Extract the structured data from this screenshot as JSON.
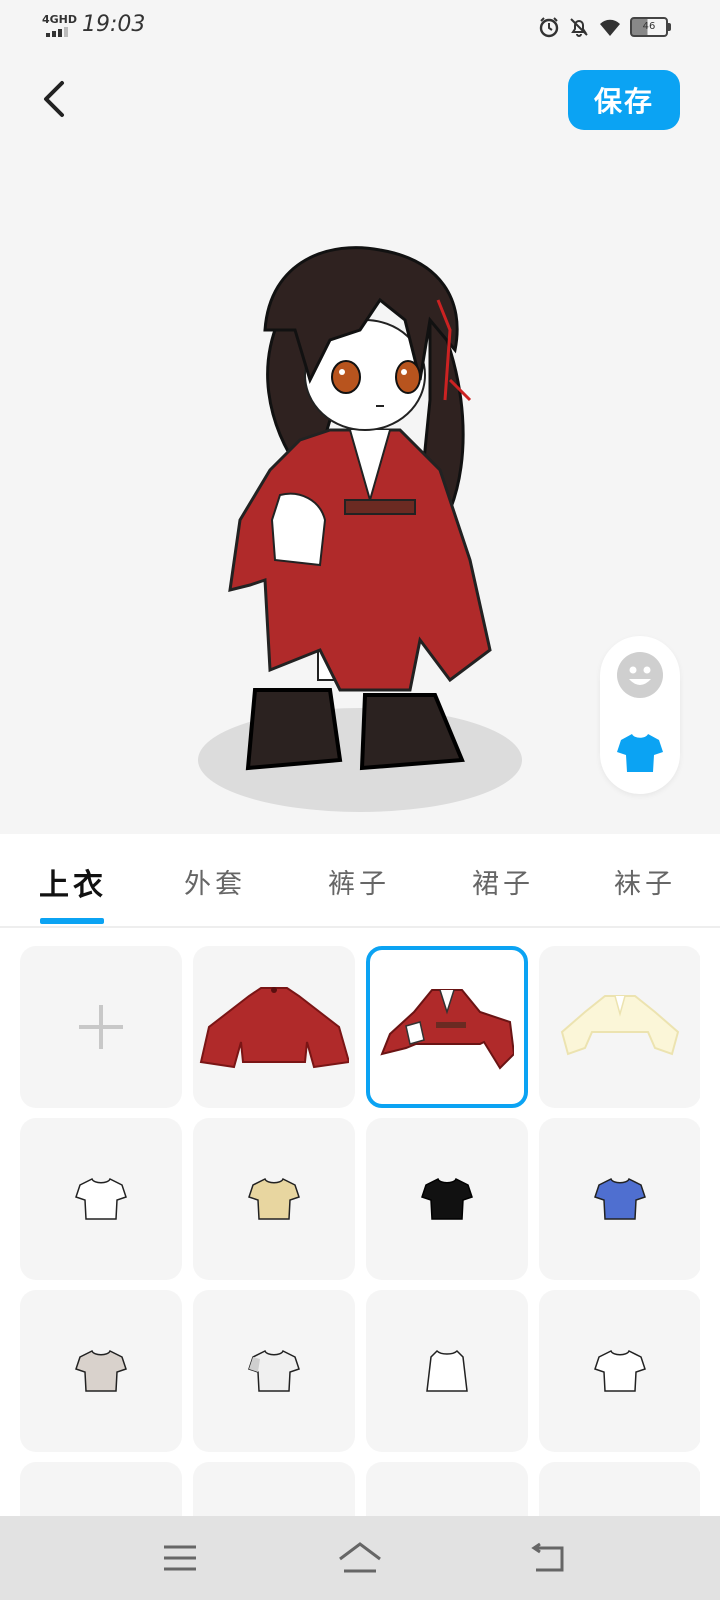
{
  "status_bar": {
    "network": "4GHD",
    "time": "19:03",
    "battery": "46"
  },
  "header": {
    "save_label": "保存"
  },
  "tabs": [
    {
      "label": "上衣",
      "active": true
    },
    {
      "label": "外套",
      "active": false
    },
    {
      "label": "裤子",
      "active": false
    },
    {
      "label": "裙子",
      "active": false
    },
    {
      "label": "袜子",
      "active": false
    }
  ],
  "items": [
    {
      "kind": "add",
      "icon": "plus-icon"
    },
    {
      "kind": "red-cape-top"
    },
    {
      "kind": "red-robe-top",
      "selected": true
    },
    {
      "kind": "cream-robe-top"
    },
    {
      "kind": "tshirt",
      "color": "#ffffff"
    },
    {
      "kind": "tshirt",
      "color": "#e8d6a0"
    },
    {
      "kind": "tshirt",
      "color": "#111111"
    },
    {
      "kind": "tshirt",
      "color": "#4f6fd0"
    },
    {
      "kind": "tshirt",
      "color": "#d9d2cc"
    },
    {
      "kind": "tshirt",
      "color": "#e8e8e8"
    },
    {
      "kind": "tank",
      "color": "#ffffff"
    },
    {
      "kind": "tshirt",
      "color": "#ffffff"
    }
  ],
  "colors": {
    "accent": "#0ba3f3",
    "robe_red": "#b02a2a",
    "hair": "#2f2220"
  }
}
